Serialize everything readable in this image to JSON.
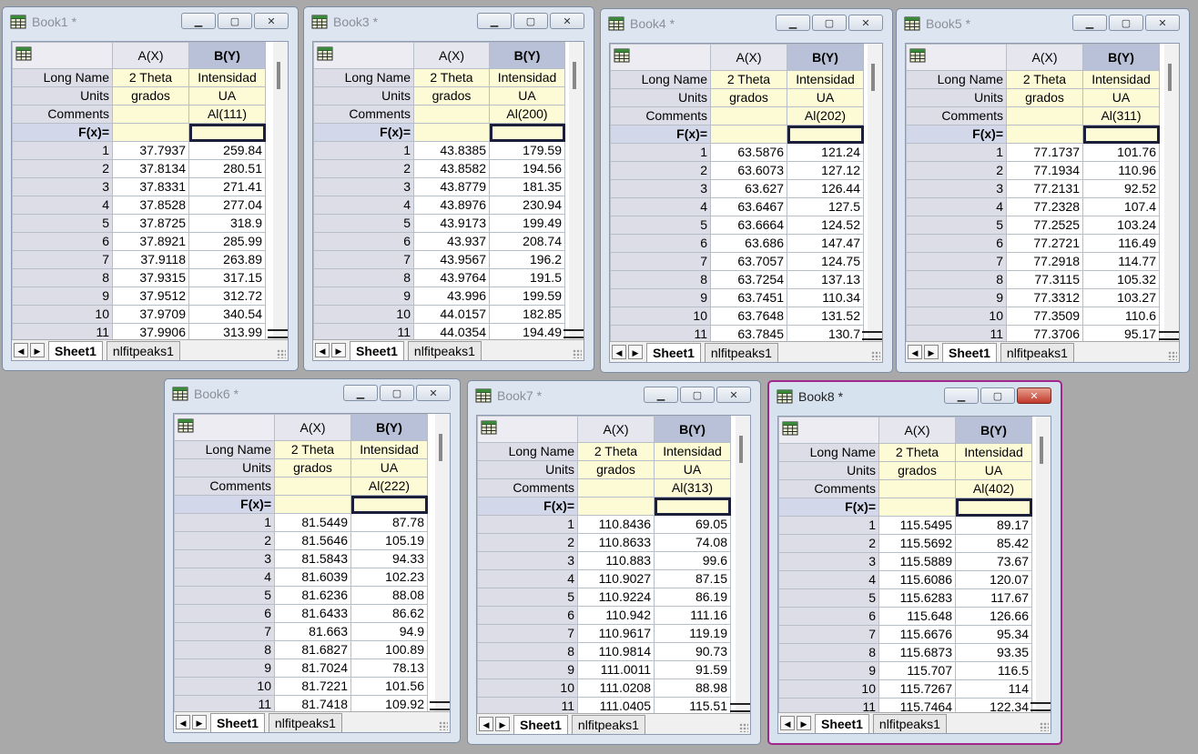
{
  "books": [
    {
      "title": "Book1 *",
      "active": false,
      "col_a": "A(X)",
      "col_b": "B(Y)",
      "long_name_a": "2 Theta",
      "long_name_b": "Intensidad",
      "units_a": "grados",
      "units_b": "UA",
      "comment_b": "Al(111)",
      "rows": [
        [
          "1",
          "37.7937",
          "259.84"
        ],
        [
          "2",
          "37.8134",
          "280.51"
        ],
        [
          "3",
          "37.8331",
          "271.41"
        ],
        [
          "4",
          "37.8528",
          "277.04"
        ],
        [
          "5",
          "37.8725",
          "318.9"
        ],
        [
          "6",
          "37.8921",
          "285.99"
        ],
        [
          "7",
          "37.9118",
          "263.89"
        ],
        [
          "8",
          "37.9315",
          "317.15"
        ],
        [
          "9",
          "37.9512",
          "312.72"
        ],
        [
          "10",
          "37.9709",
          "340.54"
        ],
        [
          "11",
          "37.9906",
          "313.99"
        ]
      ]
    },
    {
      "title": "Book3 *",
      "active": false,
      "col_a": "A(X)",
      "col_b": "B(Y)",
      "long_name_a": "2 Theta",
      "long_name_b": "Intensidad",
      "units_a": "grados",
      "units_b": "UA",
      "comment_b": "Al(200)",
      "rows": [
        [
          "1",
          "43.8385",
          "179.59"
        ],
        [
          "2",
          "43.8582",
          "194.56"
        ],
        [
          "3",
          "43.8779",
          "181.35"
        ],
        [
          "4",
          "43.8976",
          "230.94"
        ],
        [
          "5",
          "43.9173",
          "199.49"
        ],
        [
          "6",
          "43.937",
          "208.74"
        ],
        [
          "7",
          "43.9567",
          "196.2"
        ],
        [
          "8",
          "43.9764",
          "191.5"
        ],
        [
          "9",
          "43.996",
          "199.59"
        ],
        [
          "10",
          "44.0157",
          "182.85"
        ],
        [
          "11",
          "44.0354",
          "194.49"
        ]
      ]
    },
    {
      "title": "Book4 *",
      "active": false,
      "col_a": "A(X)",
      "col_b": "B(Y)",
      "long_name_a": "2 Theta",
      "long_name_b": "Intensidad",
      "units_a": "grados",
      "units_b": "UA",
      "comment_b": "Al(202)",
      "rows": [
        [
          "1",
          "63.5876",
          "121.24"
        ],
        [
          "2",
          "63.6073",
          "127.12"
        ],
        [
          "3",
          "63.627",
          "126.44"
        ],
        [
          "4",
          "63.6467",
          "127.5"
        ],
        [
          "5",
          "63.6664",
          "124.52"
        ],
        [
          "6",
          "63.686",
          "147.47"
        ],
        [
          "7",
          "63.7057",
          "124.75"
        ],
        [
          "8",
          "63.7254",
          "137.13"
        ],
        [
          "9",
          "63.7451",
          "110.34"
        ],
        [
          "10",
          "63.7648",
          "131.52"
        ],
        [
          "11",
          "63.7845",
          "130.7"
        ]
      ]
    },
    {
      "title": "Book5 *",
      "active": false,
      "col_a": "A(X)",
      "col_b": "B(Y)",
      "long_name_a": "2 Theta",
      "long_name_b": "Intensidad",
      "units_a": "grados",
      "units_b": "UA",
      "comment_b": "Al(311)",
      "rows": [
        [
          "1",
          "77.1737",
          "101.76"
        ],
        [
          "2",
          "77.1934",
          "110.96"
        ],
        [
          "3",
          "77.2131",
          "92.52"
        ],
        [
          "4",
          "77.2328",
          "107.4"
        ],
        [
          "5",
          "77.2525",
          "103.24"
        ],
        [
          "6",
          "77.2721",
          "116.49"
        ],
        [
          "7",
          "77.2918",
          "114.77"
        ],
        [
          "8",
          "77.3115",
          "105.32"
        ],
        [
          "9",
          "77.3312",
          "103.27"
        ],
        [
          "10",
          "77.3509",
          "110.6"
        ],
        [
          "11",
          "77.3706",
          "95.17"
        ]
      ]
    },
    {
      "title": "Book6 *",
      "active": false,
      "col_a": "A(X)",
      "col_b": "B(Y)",
      "long_name_a": "2 Theta",
      "long_name_b": "Intensidad",
      "units_a": "grados",
      "units_b": "UA",
      "comment_b": "Al(222)",
      "rows": [
        [
          "1",
          "81.5449",
          "87.78"
        ],
        [
          "2",
          "81.5646",
          "105.19"
        ],
        [
          "3",
          "81.5843",
          "94.33"
        ],
        [
          "4",
          "81.6039",
          "102.23"
        ],
        [
          "5",
          "81.6236",
          "88.08"
        ],
        [
          "6",
          "81.6433",
          "86.62"
        ],
        [
          "7",
          "81.663",
          "94.9"
        ],
        [
          "8",
          "81.6827",
          "100.89"
        ],
        [
          "9",
          "81.7024",
          "78.13"
        ],
        [
          "10",
          "81.7221",
          "101.56"
        ],
        [
          "11",
          "81.7418",
          "109.92"
        ]
      ]
    },
    {
      "title": "Book7 *",
      "active": false,
      "col_a": "A(X)",
      "col_b": "B(Y)",
      "long_name_a": "2 Theta",
      "long_name_b": "Intensidad",
      "units_a": "grados",
      "units_b": "UA",
      "comment_b": "Al(313)",
      "rows": [
        [
          "1",
          "110.8436",
          "69.05"
        ],
        [
          "2",
          "110.8633",
          "74.08"
        ],
        [
          "3",
          "110.883",
          "99.6"
        ],
        [
          "4",
          "110.9027",
          "87.15"
        ],
        [
          "5",
          "110.9224",
          "86.19"
        ],
        [
          "6",
          "110.942",
          "111.16"
        ],
        [
          "7",
          "110.9617",
          "119.19"
        ],
        [
          "8",
          "110.9814",
          "90.73"
        ],
        [
          "9",
          "111.0011",
          "91.59"
        ],
        [
          "10",
          "111.0208",
          "88.98"
        ],
        [
          "11",
          "111.0405",
          "115.51"
        ]
      ]
    },
    {
      "title": "Book8 *",
      "active": true,
      "col_a": "A(X)",
      "col_b": "B(Y)",
      "long_name_a": "2 Theta",
      "long_name_b": "Intensidad",
      "units_a": "grados",
      "units_b": "UA",
      "comment_b": "Al(402)",
      "rows": [
        [
          "1",
          "115.5495",
          "89.17"
        ],
        [
          "2",
          "115.5692",
          "85.42"
        ],
        [
          "3",
          "115.5889",
          "73.67"
        ],
        [
          "4",
          "115.6086",
          "120.07"
        ],
        [
          "5",
          "115.6283",
          "117.67"
        ],
        [
          "6",
          "115.648",
          "126.66"
        ],
        [
          "7",
          "115.6676",
          "95.34"
        ],
        [
          "8",
          "115.6873",
          "93.35"
        ],
        [
          "9",
          "115.707",
          "116.5"
        ],
        [
          "10",
          "115.7267",
          "114"
        ],
        [
          "11",
          "115.7464",
          "122.34"
        ]
      ]
    }
  ],
  "labels": {
    "long_name": "Long Name",
    "units": "Units",
    "comments": "Comments",
    "fx": "F(x)=",
    "sheet1": "Sheet1",
    "nlfit": "nlfitpeaks1",
    "nav_prev": "◀",
    "nav_next": "▶"
  }
}
